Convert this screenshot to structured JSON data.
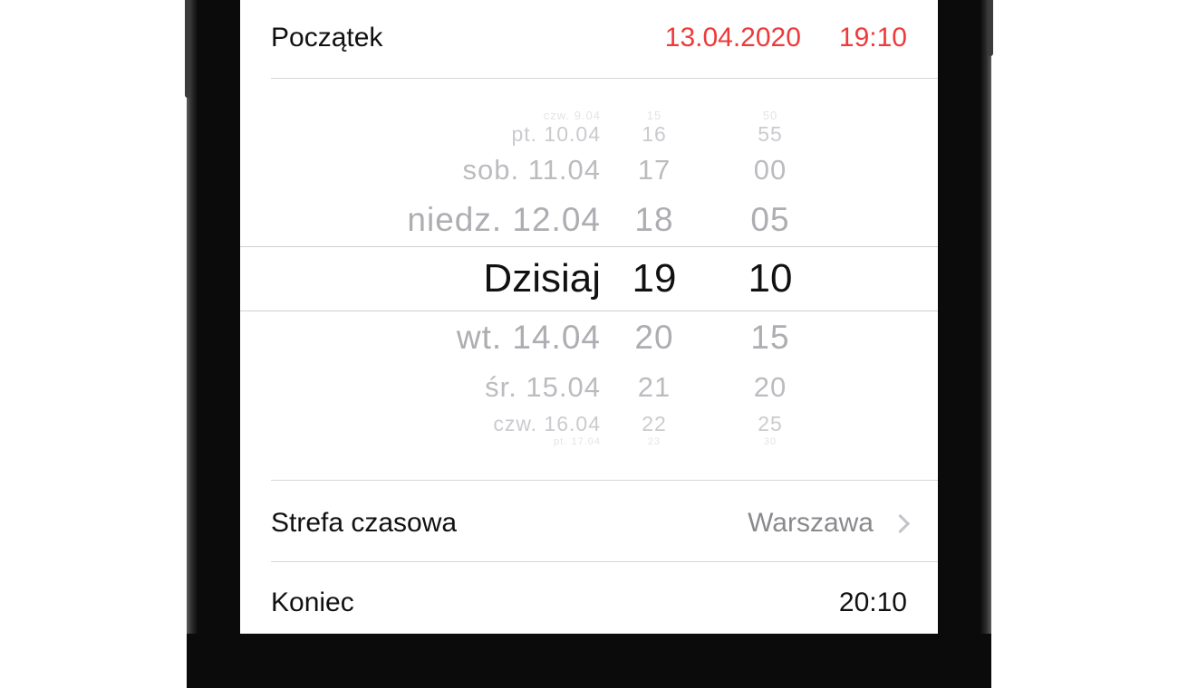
{
  "start": {
    "label": "Początek",
    "date": "13.04.2020",
    "time": "19:10"
  },
  "picker": {
    "rows": [
      {
        "date": "czw. 9.04",
        "hour": "15",
        "minute": "50"
      },
      {
        "date": "pt. 10.04",
        "hour": "16",
        "minute": "55"
      },
      {
        "date": "sob. 11.04",
        "hour": "17",
        "minute": "00"
      },
      {
        "date": "niedz. 12.04",
        "hour": "18",
        "minute": "05"
      },
      {
        "date": "Dzisiaj",
        "hour": "19",
        "minute": "10"
      },
      {
        "date": "wt. 14.04",
        "hour": "20",
        "minute": "15"
      },
      {
        "date": "śr. 15.04",
        "hour": "21",
        "minute": "20"
      },
      {
        "date": "czw. 16.04",
        "hour": "22",
        "minute": "25"
      },
      {
        "date": "pt. 17.04",
        "hour": "23",
        "minute": "30"
      }
    ]
  },
  "timezone": {
    "label": "Strefa czasowa",
    "value": "Warszawa"
  },
  "end": {
    "label": "Koniec",
    "time": "20:10"
  },
  "colors": {
    "accent_red": "#ee3a3a",
    "separator": "#d6d6da",
    "secondary_text": "#8a8a8e"
  },
  "icons": {
    "disclosure": "chevron-right-icon"
  }
}
